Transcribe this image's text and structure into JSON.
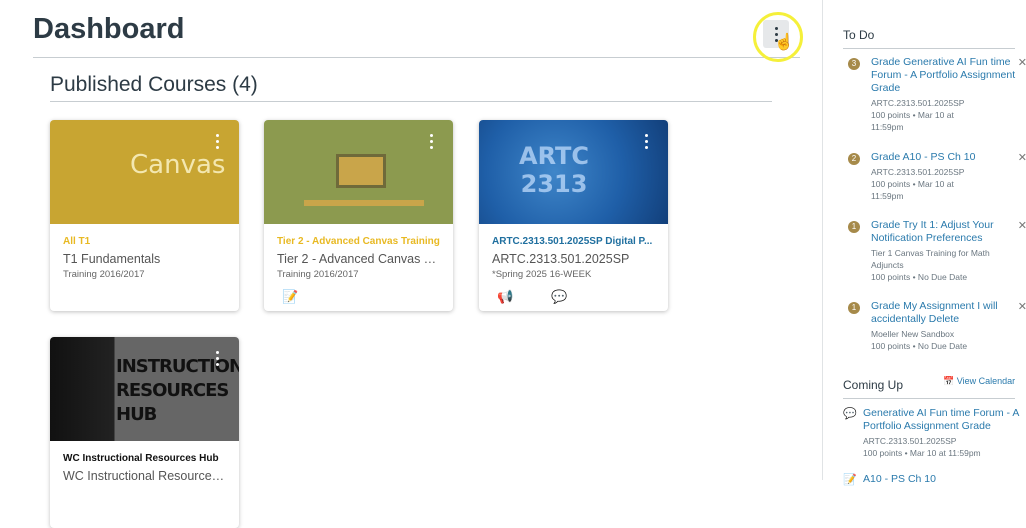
{
  "header": {
    "title": "Dashboard",
    "options_icon": "kebab-icon"
  },
  "section": {
    "title": "Published Courses (4)"
  },
  "courses": [
    {
      "nickname": "All T1",
      "code": "T1 Fundamentals",
      "term": "Training 2016/2017",
      "color": "#c8a532",
      "nick_color": "#e8b923",
      "image_text": "Canvas",
      "icons": []
    },
    {
      "nickname": "Tier 2 - Advanced Canvas Training",
      "code": "Tier 2 - Advanced Canvas Trai...",
      "term": "Training 2016/2017",
      "color": "#8c9a4f",
      "nick_color": "#e8b923",
      "icons": [
        "assignments-icon"
      ]
    },
    {
      "nickname": "ARTC.2313.501.2025SP Digital P...",
      "code": "ARTC.2313.501.2025SP",
      "term": "*Spring 2025 16-WEEK",
      "color": "#1f5fa8",
      "nick_color": "#1f6f9f",
      "image_text": "ARTC 2313",
      "icons": [
        "announcements-icon",
        "discussions-icon"
      ]
    },
    {
      "nickname": "WC Instructional Resources Hub",
      "code": "WC Instructional Resources H...",
      "term": "",
      "color": "#555555",
      "nick_color": "#111111",
      "image_text": "INSTRUCTIONAL RESOURCES HUB",
      "icons": []
    }
  ],
  "sidebar": {
    "todo_title": "To Do",
    "todo": [
      {
        "count": "3",
        "title": "Grade Generative AI Fun time Forum - A Portfolio Assignment Grade",
        "course": "ARTC.2313.501.2025SP",
        "meta": "100 points • Mar 10 at 11:59pm"
      },
      {
        "count": "2",
        "title": "Grade A10 - PS Ch 10",
        "course": "ARTC.2313.501.2025SP",
        "meta": "100 points • Mar 10 at 11:59pm"
      },
      {
        "count": "1",
        "title": "Grade Try It 1: Adjust Your Notification Preferences",
        "course": "Tier 1 Canvas Training for Math Adjuncts",
        "meta": "100 points • No Due Date"
      },
      {
        "count": "1",
        "title": "Grade My Assignment I will accidentally Delete",
        "course": "Moeller New Sandbox",
        "meta": "100 points • No Due Date"
      }
    ],
    "coming_up_title": "Coming Up",
    "view_calendar": "View Calendar",
    "coming_up": [
      {
        "title": "Generative AI Fun time Forum - A Portfolio Assignment Grade",
        "course": "ARTC.2313.501.2025SP",
        "meta": "100 points • Mar 10 at 11:59pm"
      },
      {
        "title": "A10 - PS Ch 10",
        "course": "",
        "meta": ""
      }
    ]
  }
}
